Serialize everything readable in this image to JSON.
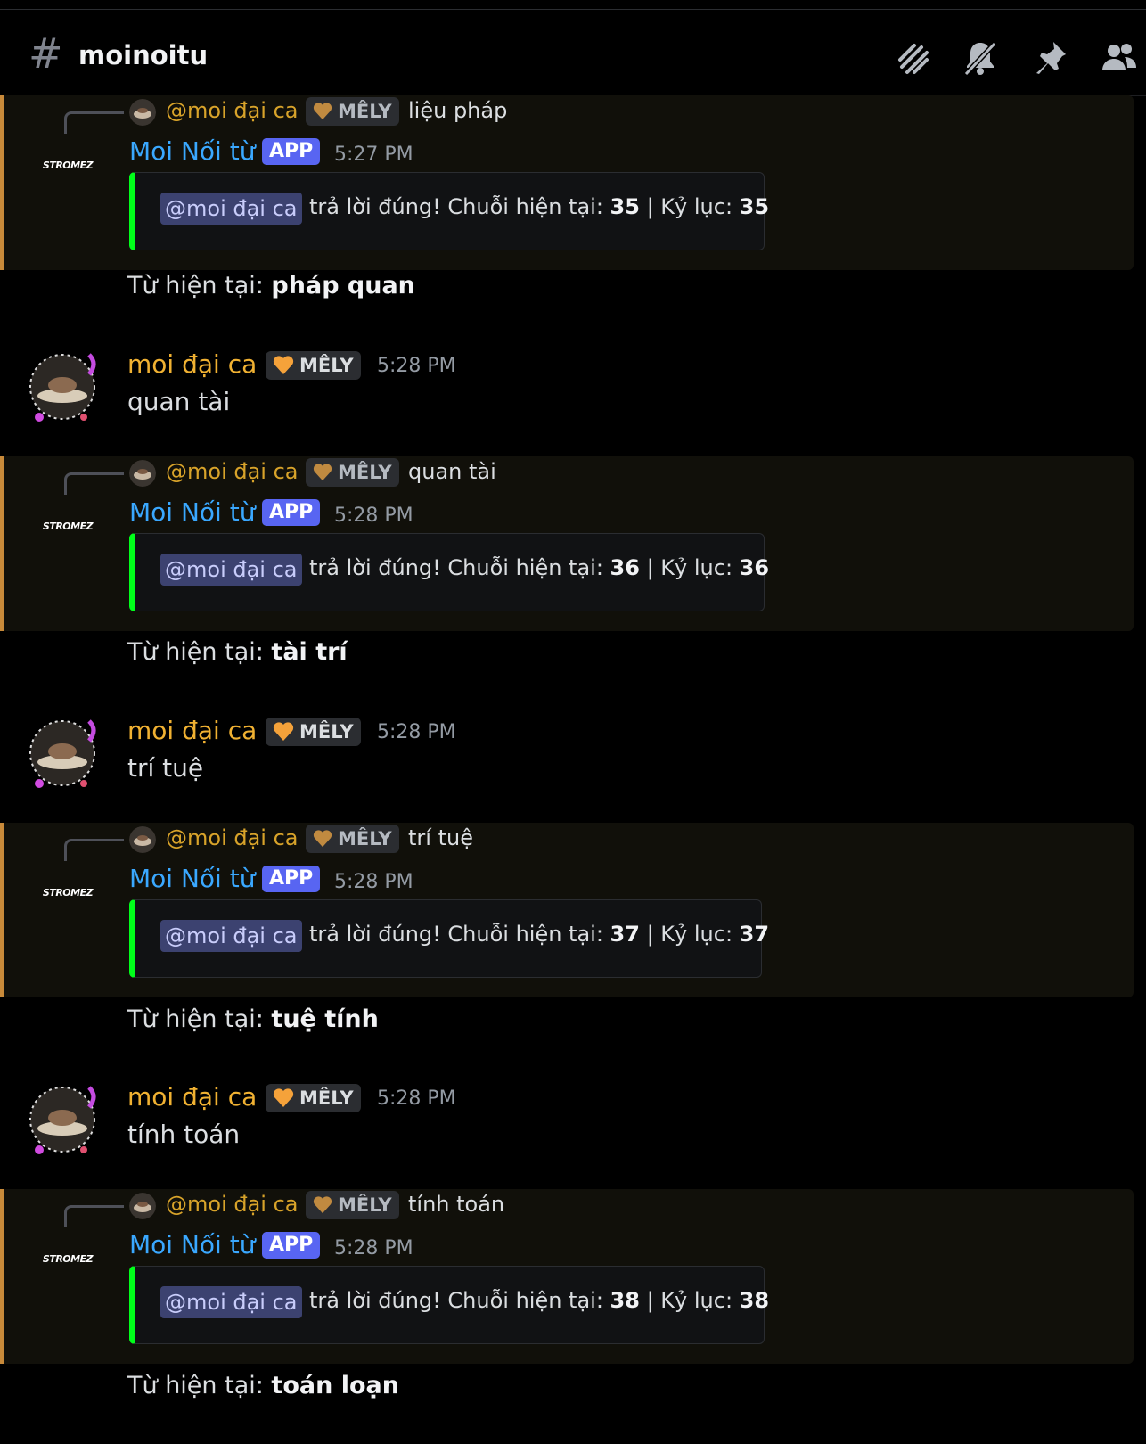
{
  "channel": {
    "name": "moinoitu"
  },
  "header_icons": [
    "threads-icon",
    "mute-bell-icon",
    "pin-icon",
    "members-icon"
  ],
  "colors": {
    "accent_bar": "#c88a3a",
    "embed_bar": "#00ff1a",
    "bot_name": "#3aa8ff",
    "user_name": "#f0b132",
    "app_tag": "#5865f2"
  },
  "messages": [
    {
      "reply": {
        "name": "@moi đại ca",
        "badge": "MÊLY",
        "text": "liệu pháp"
      },
      "bot": {
        "name": "Moi Nối từ",
        "tag": "APP",
        "time": "5:27 PM",
        "avatar_text": "STROMEZ"
      },
      "embed": {
        "mention": "@moi đại ca",
        "prefix": "trả lời đúng! Chuỗi hiện tại: ",
        "streak": "35",
        "sep": " | Kỷ lục: ",
        "record": "35"
      },
      "current": {
        "label": "Từ hiện tại: ",
        "word": "pháp quan"
      }
    },
    {
      "user": {
        "name": "moi đại ca",
        "badge": "MÊLY",
        "time": "5:28 PM",
        "text": "quan tài"
      }
    },
    {
      "reply": {
        "name": "@moi đại ca",
        "badge": "MÊLY",
        "text": "quan tài"
      },
      "bot": {
        "name": "Moi Nối từ",
        "tag": "APP",
        "time": "5:28 PM",
        "avatar_text": "STROMEZ"
      },
      "embed": {
        "mention": "@moi đại ca",
        "prefix": "trả lời đúng! Chuỗi hiện tại: ",
        "streak": "36",
        "sep": " | Kỷ lục: ",
        "record": "36"
      },
      "current": {
        "label": "Từ hiện tại: ",
        "word": "tài trí"
      }
    },
    {
      "user": {
        "name": "moi đại ca",
        "badge": "MÊLY",
        "time": "5:28 PM",
        "text": "trí tuệ"
      }
    },
    {
      "reply": {
        "name": "@moi đại ca",
        "badge": "MÊLY",
        "text": "trí tuệ"
      },
      "bot": {
        "name": "Moi Nối từ",
        "tag": "APP",
        "time": "5:28 PM",
        "avatar_text": "STROMEZ"
      },
      "embed": {
        "mention": "@moi đại ca",
        "prefix": "trả lời đúng! Chuỗi hiện tại: ",
        "streak": "37",
        "sep": " | Kỷ lục: ",
        "record": "37"
      },
      "current": {
        "label": "Từ hiện tại: ",
        "word": "tuệ tính"
      }
    },
    {
      "user": {
        "name": "moi đại ca",
        "badge": "MÊLY",
        "time": "5:28 PM",
        "text": "tính toán"
      }
    },
    {
      "reply": {
        "name": "@moi đại ca",
        "badge": "MÊLY",
        "text": "tính toán"
      },
      "bot": {
        "name": "Moi Nối từ",
        "tag": "APP",
        "time": "5:28 PM",
        "avatar_text": "STROMEZ"
      },
      "embed": {
        "mention": "@moi đại ca",
        "prefix": "trả lời đúng! Chuỗi hiện tại: ",
        "streak": "38",
        "sep": " | Kỷ lục: ",
        "record": "38"
      },
      "current": {
        "label": "Từ hiện tại: ",
        "word": "toán loạn"
      }
    }
  ]
}
